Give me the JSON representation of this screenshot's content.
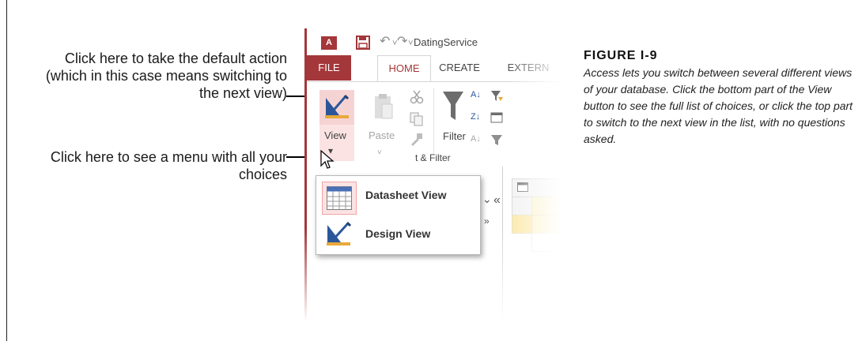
{
  "callouts": {
    "default_action": "Click here to take the default action (which in this case means switching to the next view)",
    "menu_hint": "Click here to see a menu with all your choices"
  },
  "app": {
    "logo_text": "A",
    "logo_color": "#a4373a",
    "undo_glyph": "↶",
    "redo_glyph": "↷",
    "dropdown_glyph": "˅",
    "customize_glyph": "⩡",
    "title": "DatingService"
  },
  "tabs": {
    "file": "FILE",
    "home": "HOME",
    "create": "CREATE",
    "external": "EXTERN"
  },
  "ribbon": {
    "view_label": "View",
    "view_arrow": "▾",
    "paste_label": "Paste",
    "filter_label": "Filter",
    "group_label": "t & Filter",
    "sort_asc_glyph": "A↓",
    "sort_desc_glyph": "Z↓"
  },
  "nav": {
    "chevron_down": "⌄",
    "collapse": "«",
    "expand": "»"
  },
  "menu": {
    "items": [
      {
        "label": "Datasheet View",
        "icon": "datasheet-view-icon"
      },
      {
        "label": "Design View",
        "icon": "design-view-icon"
      }
    ]
  },
  "figure": {
    "title": "FIGURE I-9",
    "caption": "Access lets you switch between several different views of your database. Click the bottom part of the View button to see the full list of choices, or click the top part to switch to the next view in the list, with no questions asked."
  },
  "colors": {
    "accent": "#a4373a",
    "view_highlight": "#f6d3d3",
    "menu_highlight": "#fbe3e3"
  }
}
